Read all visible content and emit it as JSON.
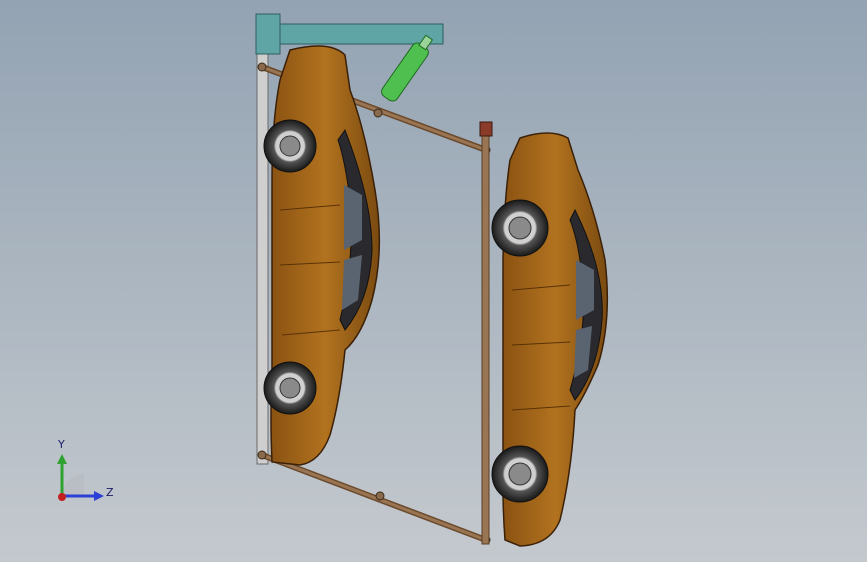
{
  "viewport": {
    "background_top": "#93a3b3",
    "background_bottom": "#c4c9ce"
  },
  "model": {
    "car_color": "#a8681c",
    "car_dark": "#6b3e0c",
    "frame_color": "#8a6a4c",
    "post_color": "#c8c8c8",
    "beam_color": "#5fa5a6",
    "cylinder_color": "#4fbf4f"
  },
  "triad": {
    "y_label": "Y",
    "z_label": "Z",
    "y_color": "#2fa32f",
    "z_color": "#2b3fd6",
    "x_color": "#c42020"
  }
}
